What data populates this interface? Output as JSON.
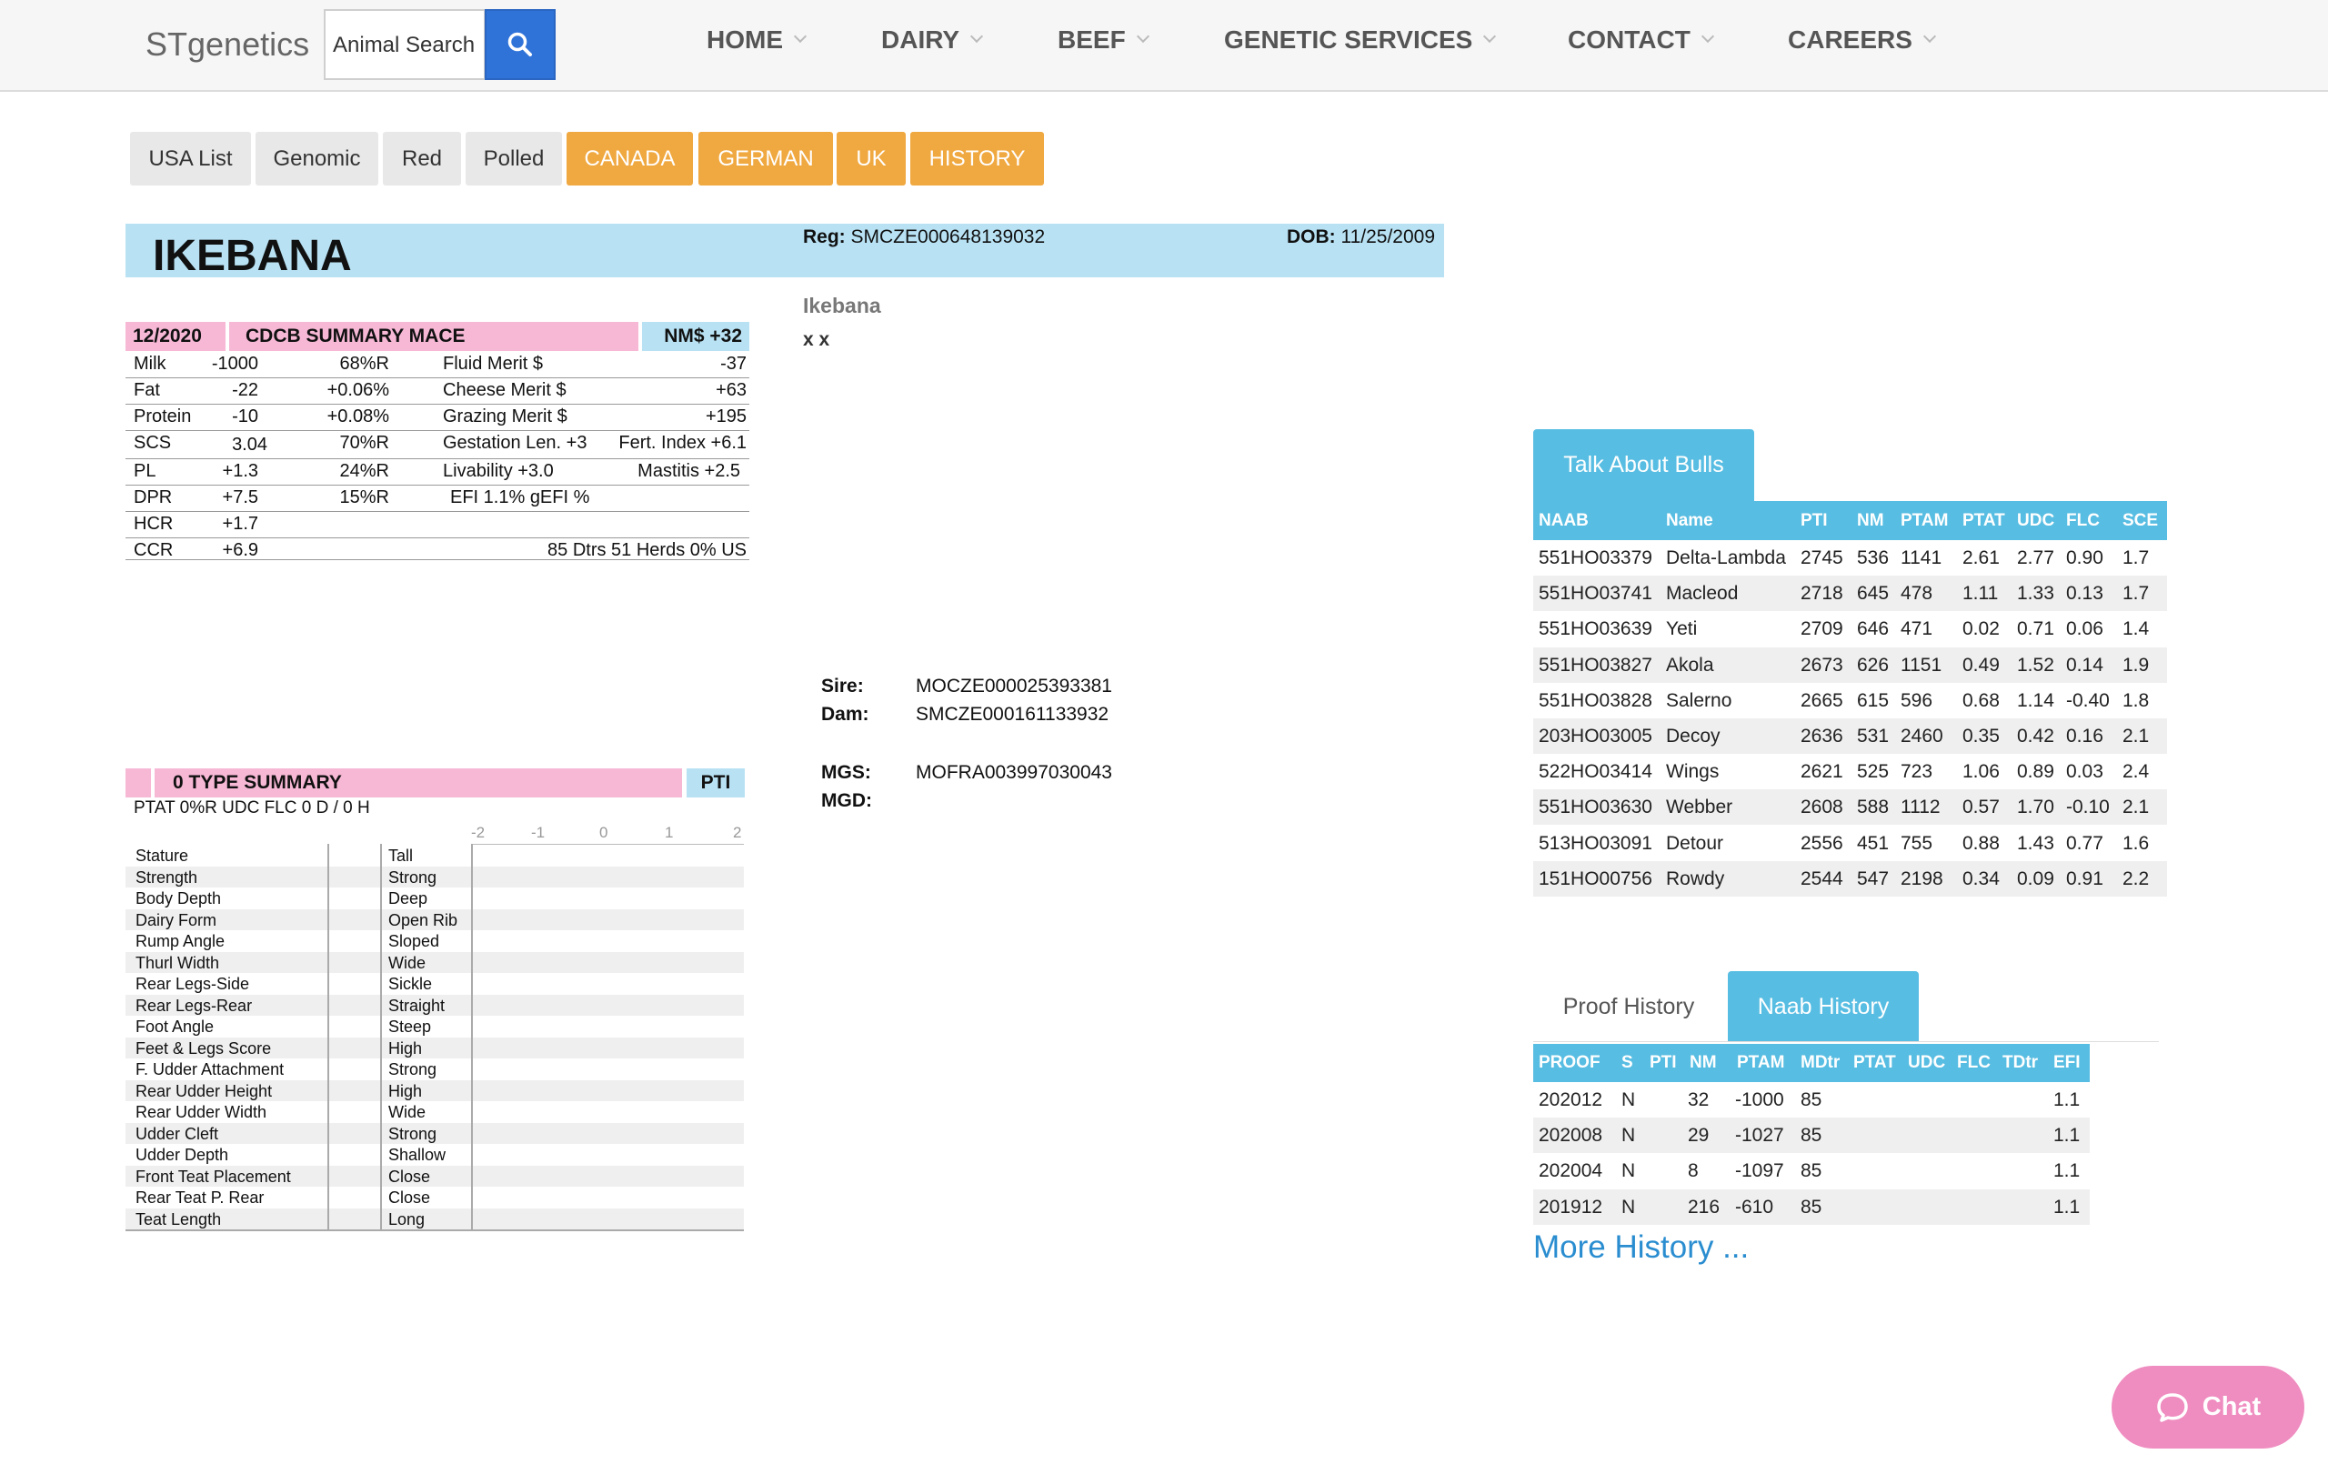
{
  "header": {
    "logo": "STgenetics",
    "search_placeholder": "Animal Search",
    "nav": [
      "HOME",
      "DAIRY",
      "BEEF",
      "GENETIC SERVICES",
      "CONTACT",
      "CAREERS"
    ]
  },
  "tabs": [
    "USA List",
    "Genomic",
    "Red",
    "Polled",
    "CANADA",
    "GERMAN",
    "UK",
    "HISTORY"
  ],
  "animal": {
    "name": "IKEBANA",
    "reg_label": "Reg:",
    "reg": "SMCZE000648139032",
    "dob_label": "DOB:",
    "dob": "11/25/2009",
    "title": "Ikebana",
    "subtitle": "x x"
  },
  "summary": {
    "date": "12/2020",
    "title": "CDCB SUMMARY MACE",
    "nm": "NM$ +32",
    "rows": [
      {
        "c1": "Milk",
        "c2": "-1000",
        "c3": "68%R",
        "c4": "Fluid Merit $",
        "c5": "-37"
      },
      {
        "c1": "Fat",
        "c2": "-22",
        "c3": "+0.06%",
        "c4": "Cheese Merit $",
        "c5": "+63"
      },
      {
        "c1": "Protein",
        "c2": "-10",
        "c3": "+0.08%",
        "c4": "Grazing Merit $",
        "c5": "+195"
      },
      {
        "c1": "SCS",
        "c2": "3.04",
        "c3": "70%R",
        "c4": "Gestation Len. +3",
        "c5": "Fert. Index +6.1"
      },
      {
        "c1": "PL",
        "c2": "+1.3",
        "c3": "24%R",
        "c4": "Livability   +3.0",
        "c5": "Mastitis   +2.5"
      },
      {
        "c1": "DPR",
        "c2": "+7.5",
        "c3": "15%R",
        "c4": "EFI  1.1%    gEFI  %",
        "c5": ""
      },
      {
        "c1": "HCR",
        "c2": "+1.7",
        "c3": "",
        "c4": "",
        "c5": ""
      },
      {
        "c1": "CCR",
        "c2": "+6.9",
        "c3": "",
        "c4": "",
        "c5": "85 Dtrs  51 Herds  0% US"
      }
    ]
  },
  "type_summary": {
    "title": "0 TYPE SUMMARY",
    "pti": "PTI",
    "sub": "PTAT   0%R  UDC  FLC    0 D /  0 H",
    "scale": [
      "-2",
      "-1",
      "0",
      "1",
      "2"
    ],
    "traits": [
      [
        "Stature",
        "Tall"
      ],
      [
        "Strength",
        "Strong"
      ],
      [
        "Body Depth",
        "Deep"
      ],
      [
        "Dairy Form",
        "Open Rib"
      ],
      [
        "Rump Angle",
        "Sloped"
      ],
      [
        "Thurl Width",
        "Wide"
      ],
      [
        "Rear Legs-Side",
        "Sickle"
      ],
      [
        "Rear Legs-Rear",
        "Straight"
      ],
      [
        "Foot Angle",
        "Steep"
      ],
      [
        "Feet & Legs Score",
        "High"
      ],
      [
        "F. Udder Attachment",
        "Strong"
      ],
      [
        "Rear Udder Height",
        "High"
      ],
      [
        "Rear Udder Width",
        "Wide"
      ],
      [
        "Udder Cleft",
        "Strong"
      ],
      [
        "Udder Depth",
        "Shallow"
      ],
      [
        "Front Teat Placement",
        "Close"
      ],
      [
        "Rear Teat P. Rear",
        "Close"
      ],
      [
        "Teat Length",
        "Long"
      ]
    ]
  },
  "pedigree": {
    "sire_label": "Sire:",
    "sire": "MOCZE000025393381",
    "dam_label": "Dam:",
    "dam": "SMCZE000161133932",
    "mgs_label": "MGS:",
    "mgs": "MOFRA003997030043",
    "mgd_label": "MGD:",
    "mgd": ""
  },
  "bulls": {
    "tab": "Talk About Bulls",
    "columns": [
      "NAAB",
      "Name",
      "PTI",
      "NM",
      "PTAM",
      "PTAT",
      "UDC",
      "FLC",
      "SCE"
    ],
    "rows": [
      [
        "551HO03379",
        "Delta-Lambda",
        "2745",
        "536",
        "1141",
        "2.61",
        "2.77",
        "0.90",
        "1.7"
      ],
      [
        "551HO03741",
        "Macleod",
        "2718",
        "645",
        "478",
        "1.11",
        "1.33",
        "0.13",
        "1.7"
      ],
      [
        "551HO03639",
        "Yeti",
        "2709",
        "646",
        "471",
        "0.02",
        "0.71",
        "0.06",
        "1.4"
      ],
      [
        "551HO03827",
        "Akola",
        "2673",
        "626",
        "1151",
        "0.49",
        "1.52",
        "0.14",
        "1.9"
      ],
      [
        "551HO03828",
        "Salerno",
        "2665",
        "615",
        "596",
        "0.68",
        "1.14",
        "-0.40",
        "1.8"
      ],
      [
        "203HO03005",
        "Decoy",
        "2636",
        "531",
        "2460",
        "0.35",
        "0.42",
        "0.16",
        "2.1"
      ],
      [
        "522HO03414",
        "Wings",
        "2621",
        "525",
        "723",
        "1.06",
        "0.89",
        "0.03",
        "2.4"
      ],
      [
        "551HO03630",
        "Webber",
        "2608",
        "588",
        "1112",
        "0.57",
        "1.70",
        "-0.10",
        "2.1"
      ],
      [
        "513HO03091",
        "Detour",
        "2556",
        "451",
        "755",
        "0.88",
        "1.43",
        "0.77",
        "1.6"
      ],
      [
        "151HO00756",
        "Rowdy",
        "2544",
        "547",
        "2198",
        "0.34",
        "0.09",
        "0.91",
        "2.2"
      ]
    ]
  },
  "history": {
    "tab_proof": "Proof History",
    "tab_naab": "Naab History",
    "columns": [
      "PROOF",
      "S",
      "PTI",
      "NM",
      "PTAM",
      "MDtr",
      "PTAT",
      "UDC",
      "FLC",
      "TDtr",
      "EFI"
    ],
    "rows": [
      [
        "202012",
        "N",
        "",
        "32",
        "-1000",
        "85",
        "",
        "",
        "",
        "",
        "1.1"
      ],
      [
        "202008",
        "N",
        "",
        "29",
        "-1027",
        "85",
        "",
        "",
        "",
        "",
        "1.1"
      ],
      [
        "202004",
        "N",
        "",
        "8",
        "-1097",
        "85",
        "",
        "",
        "",
        "",
        "1.1"
      ],
      [
        "201912",
        "N",
        "",
        "216",
        "-610",
        "85",
        "",
        "",
        "",
        "",
        "1.1"
      ]
    ],
    "more": "More History ..."
  },
  "chat": "Chat"
}
